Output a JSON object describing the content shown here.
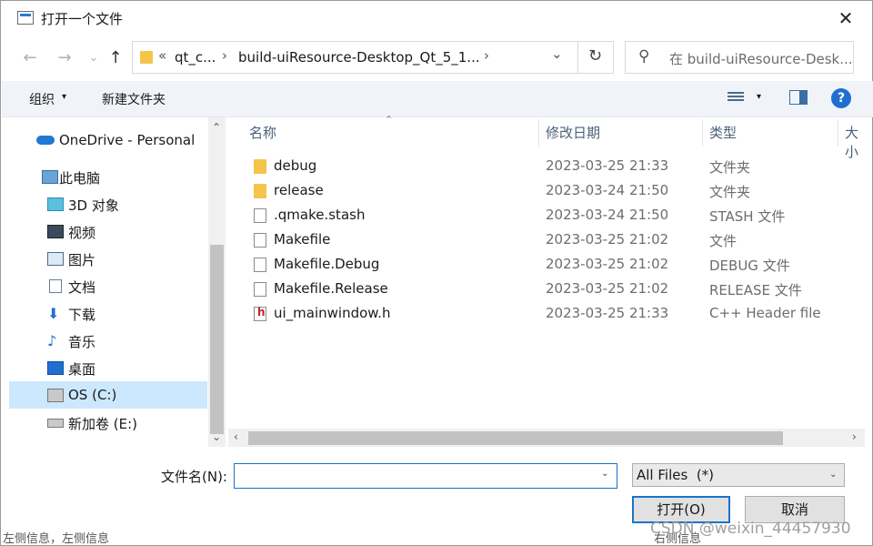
{
  "window": {
    "title": "打开一个文件",
    "close_glyph": "✕"
  },
  "nav": {
    "back": "←",
    "forward": "→",
    "recent": "⌄",
    "up": "↑"
  },
  "address": {
    "overflow": "«",
    "crumbs": [
      "qt_c...",
      "build-uiResource-Desktop_Qt_5_1..."
    ],
    "separator": "›",
    "dropdown": "⌄",
    "refresh": "↻"
  },
  "search": {
    "placeholder": "在 build-uiResource-Desk...",
    "icon": "search-icon"
  },
  "toolbar": {
    "organize": "组织",
    "new_folder": "新建文件夹",
    "help": "?"
  },
  "sidebar": {
    "items": [
      {
        "label": "OneDrive - Personal",
        "icon": "cloud-icon"
      },
      {
        "label": "此电脑",
        "icon": "computer-icon"
      },
      {
        "label": "3D 对象",
        "icon": "cube-icon"
      },
      {
        "label": "视频",
        "icon": "video-icon"
      },
      {
        "label": "图片",
        "icon": "picture-icon"
      },
      {
        "label": "文档",
        "icon": "document-icon"
      },
      {
        "label": "下载",
        "icon": "download-icon"
      },
      {
        "label": "音乐",
        "icon": "music-icon"
      },
      {
        "label": "桌面",
        "icon": "desktop-icon"
      },
      {
        "label": "OS (C:)",
        "icon": "drive-icon",
        "selected": true
      },
      {
        "label": "新加卷 (E:)",
        "icon": "drive-icon"
      }
    ]
  },
  "columns": {
    "name": "名称",
    "date": "修改日期",
    "type": "类型",
    "size": "大小"
  },
  "files": [
    {
      "name": "debug",
      "date": "2023-03-25 21:33",
      "type": "文件夹",
      "icon": "folder-icon"
    },
    {
      "name": "release",
      "date": "2023-03-24 21:50",
      "type": "文件夹",
      "icon": "folder-icon"
    },
    {
      "name": ".qmake.stash",
      "date": "2023-03-24 21:50",
      "type": "STASH 文件",
      "icon": "file-icon"
    },
    {
      "name": "Makefile",
      "date": "2023-03-25 21:02",
      "type": "文件",
      "icon": "file-icon"
    },
    {
      "name": "Makefile.Debug",
      "date": "2023-03-25 21:02",
      "type": "DEBUG 文件",
      "icon": "file-icon"
    },
    {
      "name": "Makefile.Release",
      "date": "2023-03-25 21:02",
      "type": "RELEASE 文件",
      "icon": "file-icon"
    },
    {
      "name": "ui_mainwindow.h",
      "date": "2023-03-25 21:33",
      "type": "C++ Header file",
      "icon": "header-file-icon"
    }
  ],
  "bottom": {
    "filename_label": "文件名(N):",
    "filename_value": "",
    "filter": "All Files  (*)",
    "open": "打开(O)",
    "cancel": "取消"
  },
  "watermark": "CSDN @weixin_44457930",
  "behind": {
    "left": "左侧信息，左侧信息",
    "right": "右侧信息"
  },
  "colors": {
    "accent": "#1a73c8",
    "selected": "#cce8ff",
    "folder": "#f5c44a"
  }
}
